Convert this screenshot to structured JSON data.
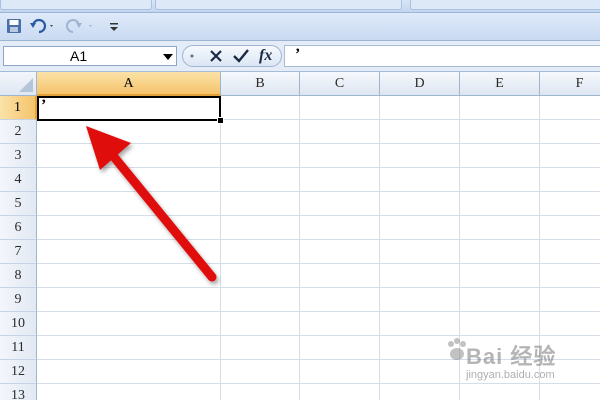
{
  "ribbon": {
    "tabs": [
      "",
      "",
      ""
    ]
  },
  "quick_access": {
    "save_icon": "save-icon",
    "undo_icon": "undo-icon",
    "redo_icon": "redo-icon",
    "customize_icon": "customize-qat-icon"
  },
  "formula_bar": {
    "name_box": "A1",
    "cancel_icon": "cancel-icon",
    "enter_icon": "check-icon",
    "fx_label": "fx",
    "value": "’"
  },
  "sheet": {
    "columns": [
      "A",
      "B",
      "C",
      "D",
      "E",
      "F"
    ],
    "rows": [
      "1",
      "2",
      "3",
      "4",
      "5",
      "6",
      "7",
      "8",
      "9",
      "10",
      "11",
      "12",
      "13"
    ],
    "selected_column": "A",
    "selected_row": "1",
    "active_cell_value": "’"
  },
  "annotation": {
    "arrow_color": "#e01010"
  },
  "watermark": {
    "text": "Bai 经验",
    "sub": "jingyan.baidu.com"
  }
}
